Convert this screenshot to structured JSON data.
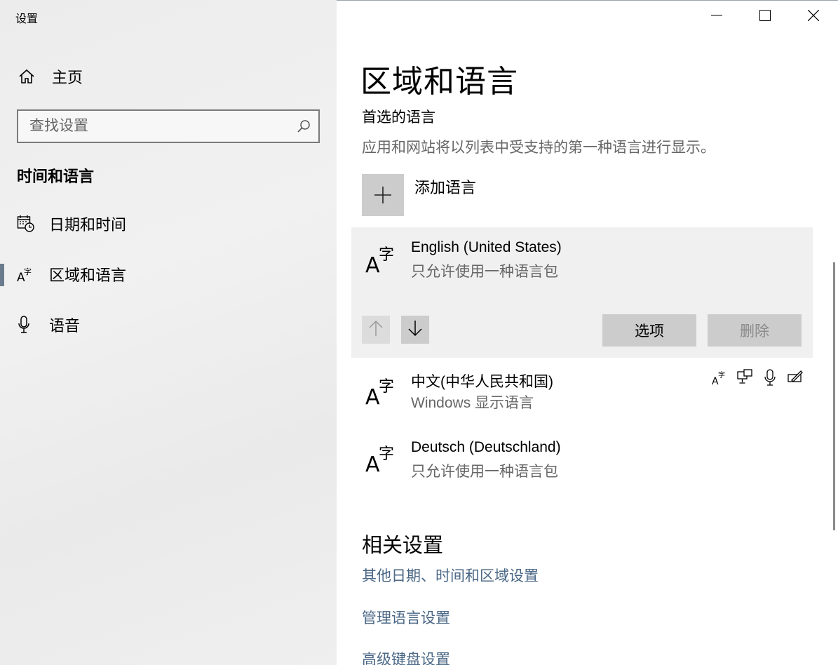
{
  "window": {
    "app_title": "设置",
    "controls": [
      "minimize-icon",
      "maximize-icon",
      "close-icon"
    ]
  },
  "sidebar": {
    "home_label": "主页",
    "search_placeholder": "查找设置",
    "section_title": "时间和语言",
    "items": [
      {
        "label": "日期和时间",
        "icon": "calendar-clock-icon",
        "selected": false
      },
      {
        "label": "区域和语言",
        "icon": "language-icon",
        "selected": true
      },
      {
        "label": "语音",
        "icon": "microphone-icon",
        "selected": false
      }
    ]
  },
  "main": {
    "title": "区域和语言",
    "preferred_heading": "首选的语言",
    "preferred_desc": "应用和网站将以列表中受支持的第一种语言进行显示。",
    "add_language_label": "添加语言",
    "languages": [
      {
        "name": "English (United States)",
        "status": "只允许使用一种语言包"
      },
      {
        "name": "中文(中华人民共和国)",
        "status": "Windows 显示语言"
      },
      {
        "name": "Deutsch (Deutschland)",
        "status": "只允许使用一种语言包"
      }
    ],
    "options_label": "选项",
    "remove_label": "删除",
    "feature_icons": [
      "language-pack-icon",
      "display-language-icon",
      "speech-icon",
      "handwriting-icon"
    ],
    "related_title": "相关设置",
    "related_links": [
      "其他日期、时间和区域设置",
      "管理语言设置",
      "高级键盘设置"
    ]
  },
  "colors": {
    "link": "#4a6786",
    "selection_bar": "#6b7b8e",
    "button_bg": "#cccccc",
    "selected_row_bg": "#f0f0f0"
  }
}
